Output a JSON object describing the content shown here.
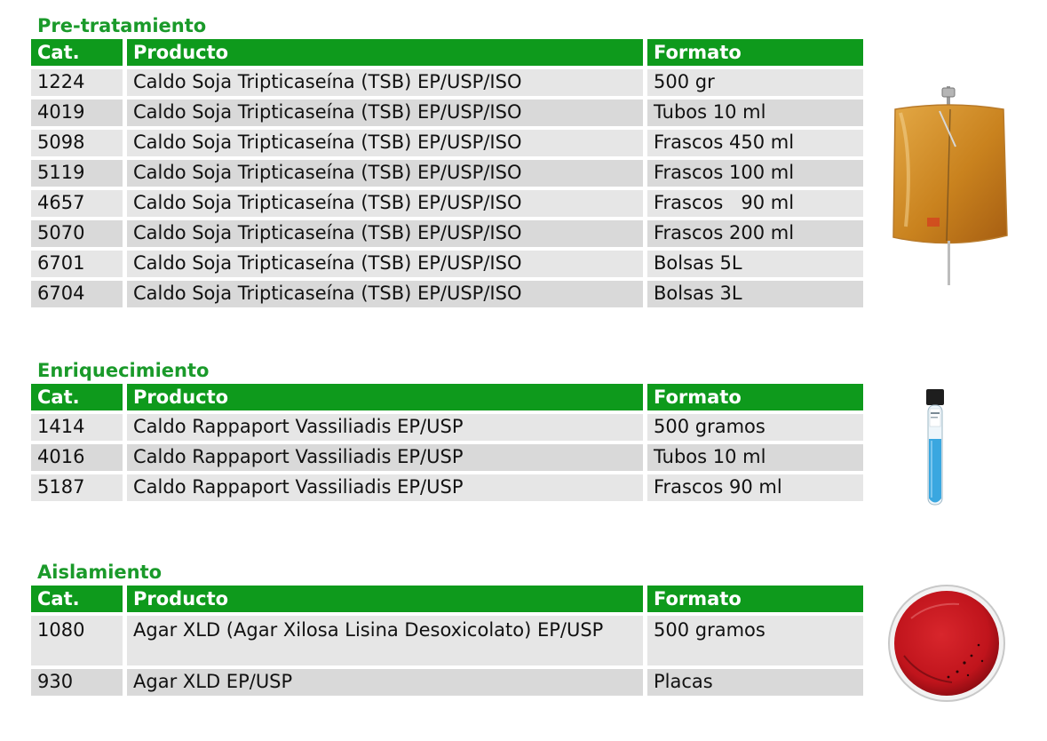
{
  "sections": [
    {
      "title": "Pre-tratamiento",
      "header": [
        "Cat.",
        "Producto",
        "Formato"
      ],
      "rows": [
        [
          "1224",
          "Caldo Soja Tripticaseína (TSB) EP/USP/ISO",
          "500 gr"
        ],
        [
          "4019",
          "Caldo Soja Tripticaseína (TSB) EP/USP/ISO",
          "Tubos 10 ml"
        ],
        [
          "5098",
          "Caldo Soja Tripticaseína (TSB) EP/USP/ISO",
          "Frascos 450 ml"
        ],
        [
          "5119",
          "Caldo Soja Tripticaseína (TSB) EP/USP/ISO",
          "Frascos 100 ml"
        ],
        [
          "4657",
          "Caldo Soja Tripticaseína (TSB) EP/USP/ISO",
          "Frascos   90 ml"
        ],
        [
          "5070",
          "Caldo Soja Tripticaseína (TSB) EP/USP/ISO",
          "Frascos 200 ml"
        ],
        [
          "6701",
          "Caldo Soja Tripticaseína (TSB) EP/USP/ISO",
          "Bolsas 5L"
        ],
        [
          "6704",
          "Caldo Soja Tripticaseína (TSB) EP/USP/ISO",
          "Bolsas 3L"
        ]
      ],
      "image": "broth-bag-image"
    },
    {
      "title": "Enriquecimiento",
      "header": [
        "Cat.",
        "Producto",
        "Formato"
      ],
      "rows": [
        [
          "1414",
          "Caldo Rappaport Vassiliadis EP/USP",
          "500 gramos"
        ],
        [
          "4016",
          "Caldo Rappaport Vassiliadis EP/USP",
          "Tubos 10 ml"
        ],
        [
          "5187",
          "Caldo Rappaport Vassiliadis EP/USP",
          "Frascos 90 ml"
        ]
      ],
      "image": "blue-broth-tube-image"
    },
    {
      "title": "Aislamiento",
      "header": [
        "Cat.",
        "Producto",
        "Formato"
      ],
      "rows": [
        [
          "1080",
          "Agar XLD (Agar Xilosa Lisina Desoxicolato) EP/USP",
          "500 gramos"
        ],
        [
          "930",
          "Agar XLD EP/USP",
          "Placas"
        ]
      ],
      "image": "red-agar-plate-image"
    }
  ],
  "colors": {
    "title_green": "#1a9a2a",
    "header_green": "#0e9a1c",
    "row_light": "#e6e6e6",
    "row_dark": "#d9d9d9",
    "broth_amber": "#c9821e",
    "tube_blue": "#3aa7e0",
    "agar_red": "#c0141c"
  }
}
